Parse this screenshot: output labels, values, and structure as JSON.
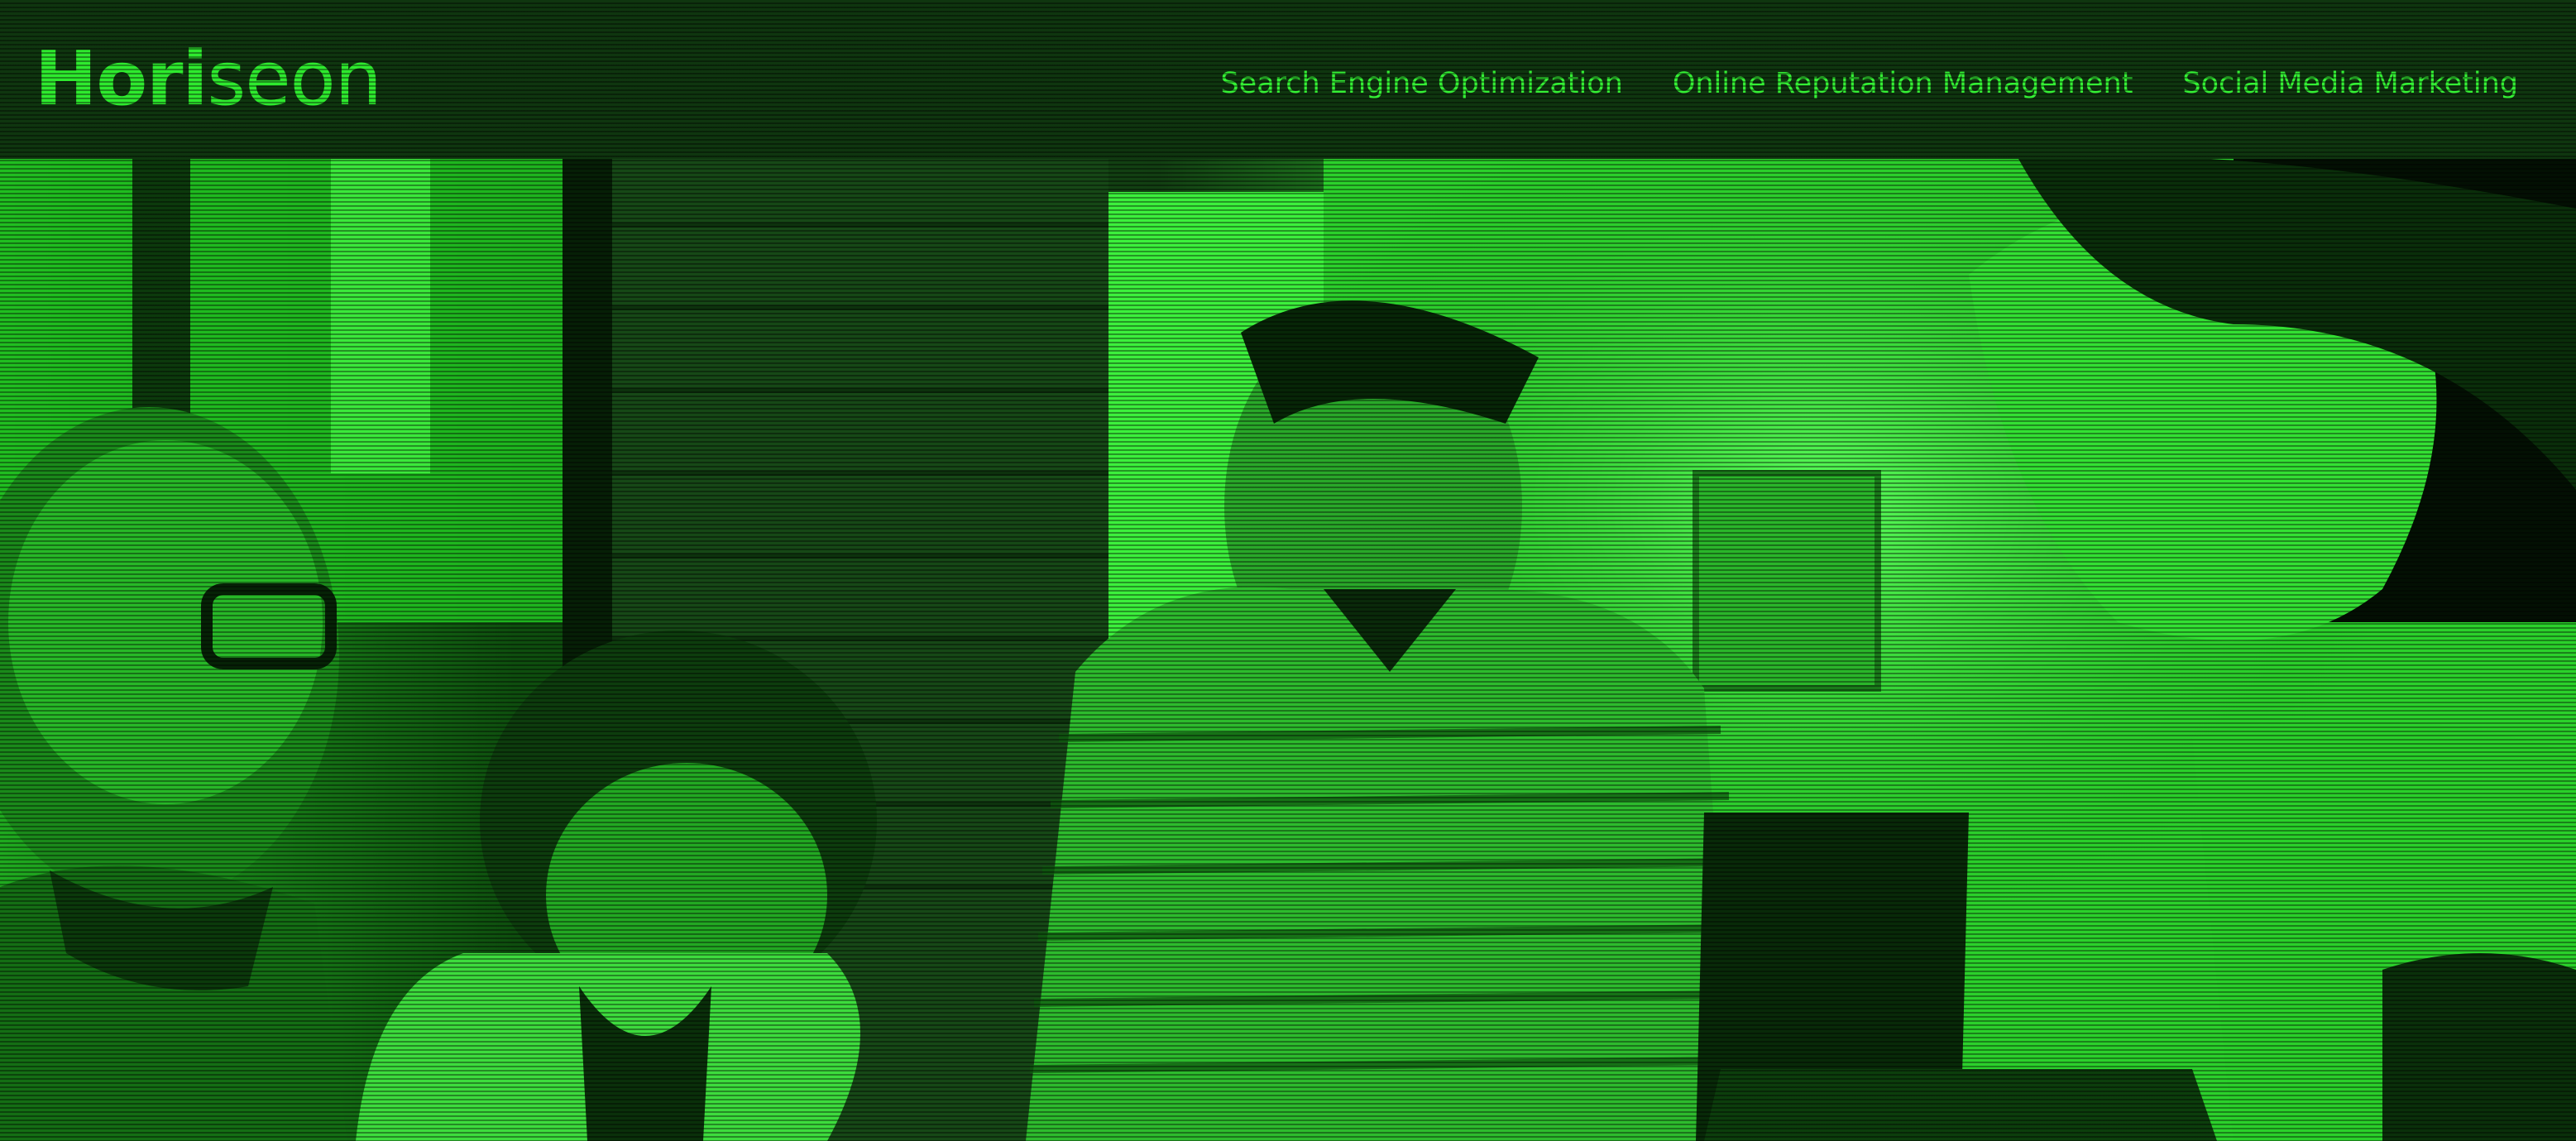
{
  "header": {
    "logo": {
      "part1": "Hori",
      "part2": "seon"
    },
    "nav": [
      {
        "label": "Search Engine Optimization"
      },
      {
        "label": "Online Reputation Management"
      },
      {
        "label": "Social Media Marketing"
      }
    ]
  },
  "hero": {
    "image": "team-collaborating-photo"
  },
  "colors": {
    "accent": "#2eea2e",
    "header_bg": "#0f360f",
    "tint": "#00ff00"
  }
}
